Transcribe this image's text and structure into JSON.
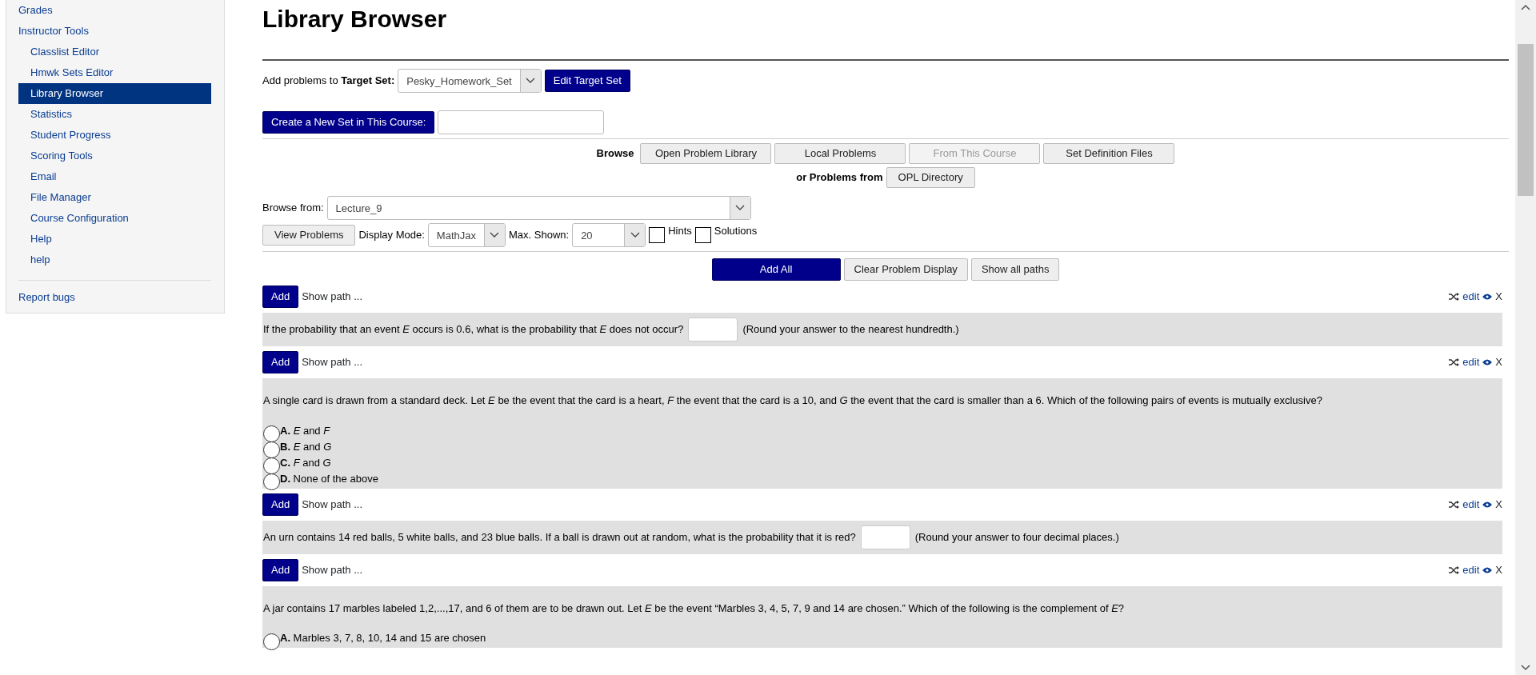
{
  "sidebar": {
    "items": [
      {
        "label": "Grades",
        "selected": false
      },
      {
        "label": "Instructor Tools",
        "selected": false,
        "children": [
          {
            "label": "Classlist Editor",
            "selected": false
          },
          {
            "label": "Hmwk Sets Editor",
            "selected": false
          },
          {
            "label": "Library Browser",
            "selected": true
          },
          {
            "label": "Statistics",
            "selected": false
          },
          {
            "label": "Student Progress",
            "selected": false
          },
          {
            "label": "Scoring Tools",
            "selected": false
          },
          {
            "label": "Email",
            "selected": false
          },
          {
            "label": "File Manager",
            "selected": false
          },
          {
            "label": "Course Configuration",
            "selected": false
          },
          {
            "label": "Help",
            "selected": false
          },
          {
            "label": "help",
            "selected": false
          }
        ]
      }
    ],
    "footer_link": "Report bugs"
  },
  "page_title": "Library Browser",
  "target_set": {
    "label": "Add problems to **Target Set:**",
    "value": "Pesky_Homework_Set",
    "button": "Edit Target Set"
  },
  "new_set": {
    "button": "Create a New Set in This Course:"
  },
  "browse": {
    "label": "Browse",
    "buttons": [
      {
        "label": "Open Problem Library",
        "disabled": false
      },
      {
        "label": "Local Problems",
        "disabled": false
      },
      {
        "label": "From This Course",
        "disabled": true
      },
      {
        "label": "Set Definition Files",
        "disabled": false
      }
    ],
    "or_label": "or Problems from",
    "opl_button": "OPL Directory"
  },
  "browse_from": {
    "label": "Browse from:",
    "value": "Lecture_9"
  },
  "view_button": "View Problems",
  "display_mode": {
    "label": "Display Mode:",
    "value": "MathJax"
  },
  "max_shown": {
    "label": "Max. Shown:",
    "value": "20"
  },
  "hints": {
    "label": "Hints",
    "checked": false
  },
  "solutions": {
    "label": "Solutions",
    "checked": false
  },
  "actions": [
    {
      "label": "Add All",
      "kind": "primary"
    },
    {
      "label": "Clear Problem Display",
      "kind": "plain"
    },
    {
      "label": "Show all paths",
      "kind": "plain"
    }
  ],
  "problems": [
    {
      "kind": "answer",
      "add_button": "Add",
      "path_link": "Show path ...",
      "edit_link": "edit",
      "remove_link": "X",
      "text": "If the probability that an event *E* occurs is 0.6, what is the probability that *E* does not occur?",
      "note": "(Round your answer to the nearest hundredth.)"
    },
    {
      "kind": "choice",
      "add_button": "Add",
      "path_link": "Show path ...",
      "edit_link": "edit",
      "remove_link": "X",
      "text": "A single card is drawn from a standard deck. Let *E* be the event that the card is a heart, *F* the event that the card is a 10, and *G* the event that the card is smaller than a 6. Which of the following pairs of events is mutually exclusive?",
      "choices": [
        {
          "label": "**A.** *E* and *F*",
          "selected": false
        },
        {
          "label": "**B.** *E* and *G*",
          "selected": false
        },
        {
          "label": "**C.** *F* and *G*",
          "selected": false
        },
        {
          "label": "**D.** None of the above",
          "selected": false
        }
      ]
    },
    {
      "kind": "answer",
      "add_button": "Add",
      "path_link": "Show path ...",
      "edit_link": "edit",
      "remove_link": "X",
      "text": "An urn contains 14 red balls, 5 white balls, and 23 blue balls. If a ball is drawn out at random, what is the probability that it is red?",
      "note": "(Round your answer to four decimal places.)"
    },
    {
      "kind": "choice",
      "add_button": "Add",
      "path_link": "Show path ...",
      "edit_link": "edit",
      "remove_link": "X",
      "text": "A jar contains 17 marbles labeled 1,2,...,17, and 6 of them are to be drawn out. Let *E* be the event “Marbles 3, 4, 5, 7, 9 and 14 are chosen.” Which of the following is the complement of *E*?",
      "choices": [
        {
          "label": "**A.** Marbles 3, 7, 8, 10, 14 and 15 are chosen",
          "selected": false
        }
      ]
    }
  ]
}
